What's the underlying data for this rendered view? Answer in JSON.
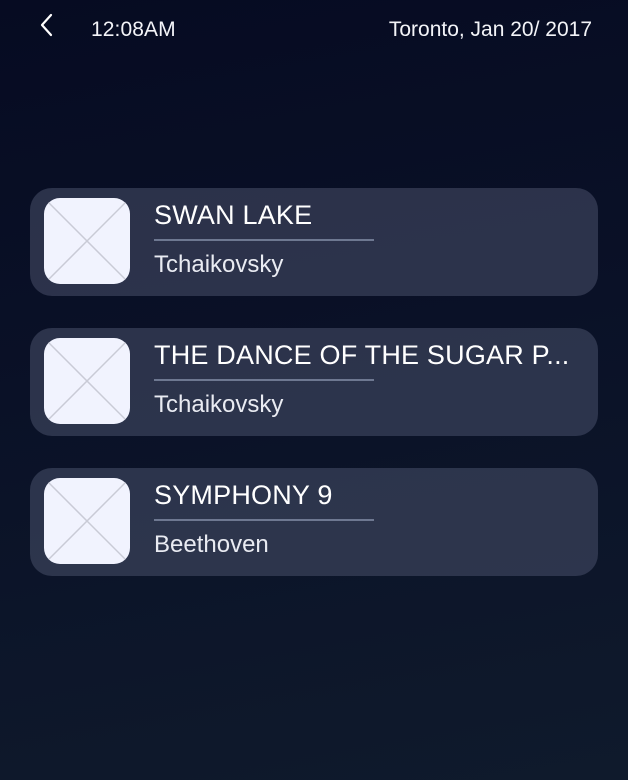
{
  "status_bar": {
    "time": "12:08AM",
    "location_date": "Toronto, Jan 20/ 2017",
    "back_icon": "chevron-left-icon"
  },
  "tracks": [
    {
      "title": "SWAN LAKE",
      "artist": "Tchaikovsky",
      "thumbnail_icon": "image-placeholder-icon"
    },
    {
      "title": "THE DANCE OF THE SUGAR P...",
      "artist": "Tchaikovsky",
      "thumbnail_icon": "image-placeholder-icon"
    },
    {
      "title": "SYMPHONY 9",
      "artist": "Beethoven",
      "thumbnail_icon": "image-placeholder-icon"
    }
  ],
  "colors": {
    "background_top": "#060b22",
    "background_bottom": "#0f1a2c",
    "card": "#3a4160",
    "thumbnail": "#f1f3fe",
    "divider": "#6e7891"
  }
}
